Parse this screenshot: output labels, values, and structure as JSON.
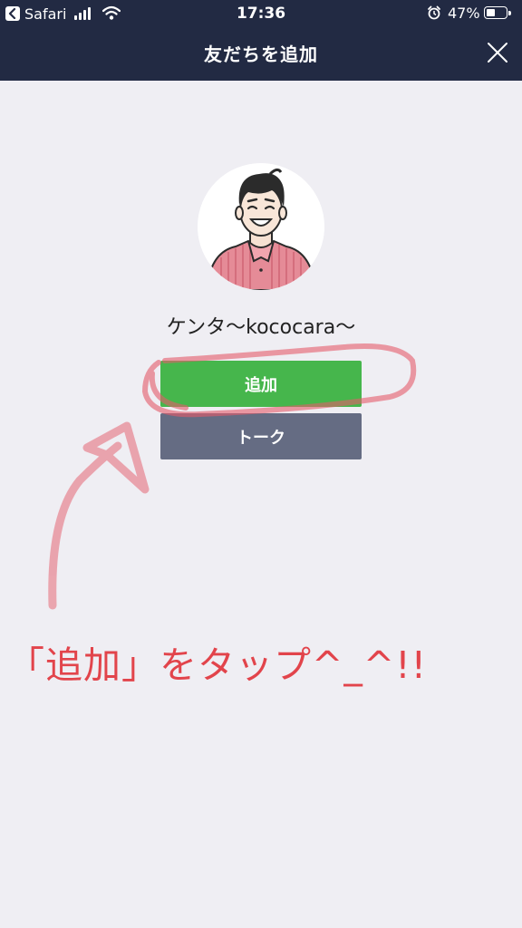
{
  "status": {
    "app": "Safari",
    "time": "17:36",
    "battery": "47%",
    "battery_level": 0.47
  },
  "header": {
    "title": "友だちを追加",
    "close_icon": "close-icon"
  },
  "profile": {
    "name": "ケンタ〜kococara〜",
    "avatar_icon": "avatar-illustration"
  },
  "actions": {
    "add_label": "追加",
    "talk_label": "トーク"
  },
  "annotation": {
    "text": "「追加」をタップ^_^!!",
    "color": "#e2444b"
  },
  "colors": {
    "header_bg": "#222a43",
    "add_button": "#46b64c",
    "talk_button": "#656c83",
    "page_bg": "#efeef3"
  }
}
